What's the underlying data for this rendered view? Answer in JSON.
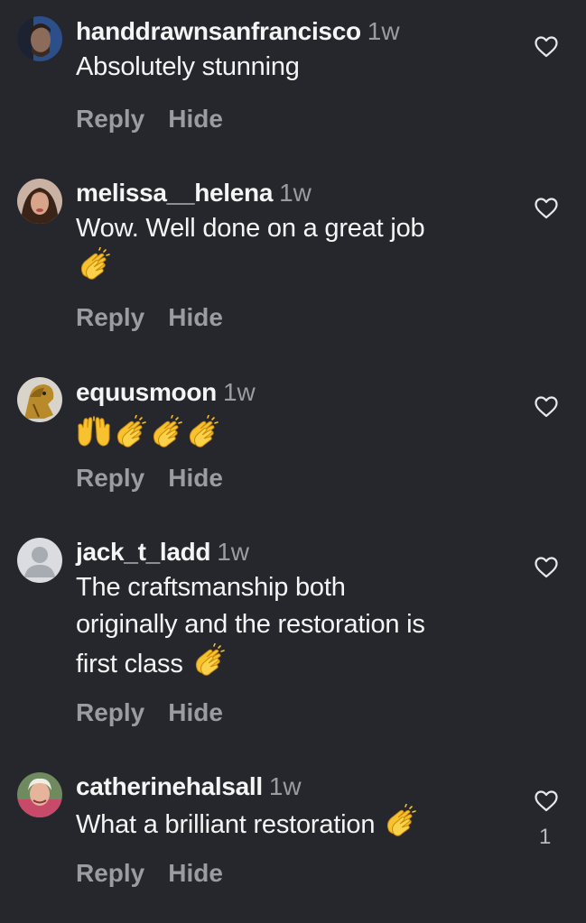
{
  "comments": [
    {
      "username": "handdrawnsanfrancisco",
      "time": "1w",
      "text": "Absolutely stunning",
      "emoji_after_text": [],
      "emoji_line": [],
      "reply_label": "Reply",
      "hide_label": "Hide",
      "like_count": null
    },
    {
      "username": "melissa__helena",
      "time": "1w",
      "text": "Wow. Well done on a great job",
      "emoji_after_text": [],
      "emoji_line": [
        "clapping-hands"
      ],
      "reply_label": "Reply",
      "hide_label": "Hide",
      "like_count": null
    },
    {
      "username": "equusmoon",
      "time": "1w",
      "text": "",
      "emoji_after_text": [],
      "emoji_line": [
        "raising-hands",
        "clapping-hands",
        "clapping-hands",
        "clapping-hands"
      ],
      "reply_label": "Reply",
      "hide_label": "Hide",
      "like_count": null
    },
    {
      "username": "jack_t_ladd",
      "time": "1w",
      "text_lines": [
        "The craftsmanship both",
        "originally and the restoration is",
        "first class"
      ],
      "emoji_after_text": [
        "clapping-hands"
      ],
      "emoji_line": [],
      "reply_label": "Reply",
      "hide_label": "Hide",
      "like_count": null
    },
    {
      "username": "catherinehalsall",
      "time": "1w",
      "text": "What a brilliant restoration",
      "emoji_after_text": [
        "clapping-hands"
      ],
      "emoji_line": [],
      "reply_label": "Reply",
      "hide_label": "Hide",
      "like_count": "1"
    }
  ],
  "colors": {
    "background": "#25272c",
    "primary_text": "#f5f5f5",
    "secondary_text": "#9a9ca2",
    "emoji_yellow": "#f7c12f"
  }
}
